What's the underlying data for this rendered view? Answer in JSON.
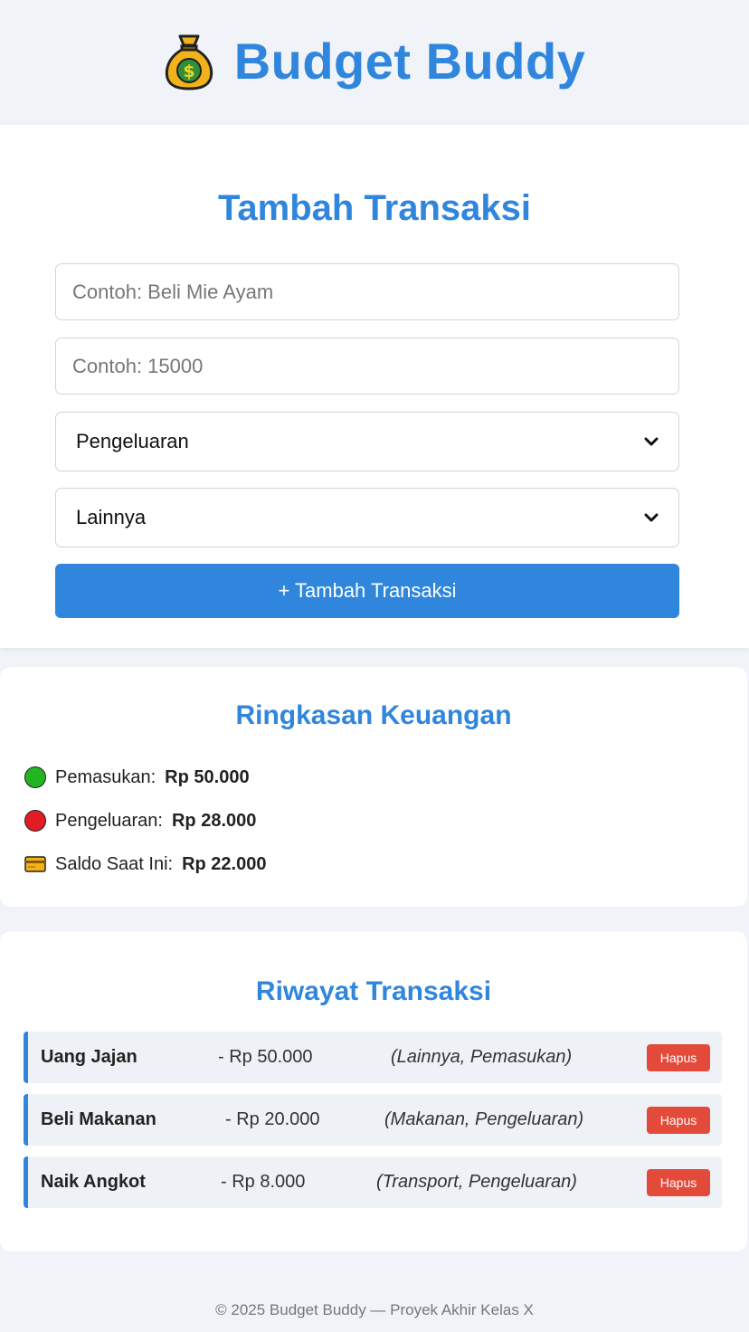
{
  "header": {
    "title": "Budget Buddy",
    "logo_icon": "money-bag-icon"
  },
  "form": {
    "title": "Tambah Transaksi",
    "description_placeholder": "Contoh: Beli Mie Ayam",
    "amount_placeholder": "Contoh: 15000",
    "type_selected": "Pengeluaran",
    "category_selected": "Lainnya",
    "submit_label": "+ Tambah Transaksi"
  },
  "summary": {
    "title": "Ringkasan Keuangan",
    "income_label": "Pemasukan:",
    "income_value": "Rp 50.000",
    "expense_label": "Pengeluaran:",
    "expense_value": "Rp 28.000",
    "balance_label": "Saldo Saat Ini:",
    "balance_value": "Rp 22.000"
  },
  "history": {
    "title": "Riwayat Transaksi",
    "delete_label": "Hapus",
    "items": [
      {
        "name": "Uang Jajan",
        "amount": "- Rp 50.000",
        "meta": "(Lainnya, Pemasukan)"
      },
      {
        "name": "Beli Makanan",
        "amount": "- Rp 20.000",
        "meta": "(Makanan, Pengeluaran)"
      },
      {
        "name": "Naik Angkot",
        "amount": "- Rp 8.000",
        "meta": "(Transport, Pengeluaran)"
      }
    ]
  },
  "footer": {
    "text": "© 2025 Budget Buddy — Proyek Akhir Kelas X"
  },
  "colors": {
    "accent": "#2f86dc",
    "danger": "#e34a3a",
    "income_dot": "#22b522",
    "expense_dot": "#e31b23",
    "background": "#f0f3f7"
  }
}
